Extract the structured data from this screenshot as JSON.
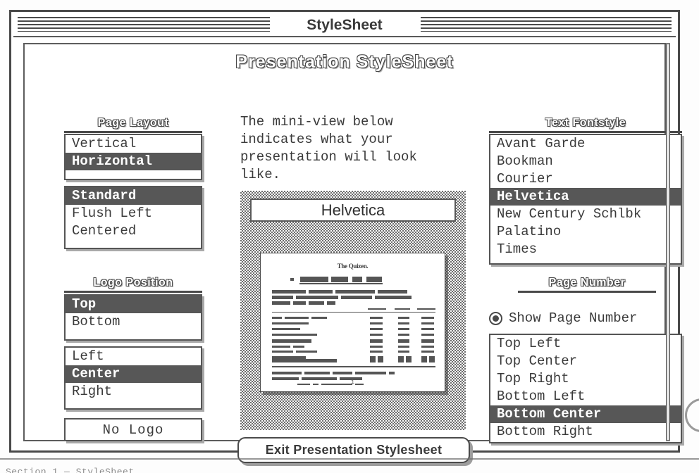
{
  "window": {
    "title": "StyleSheet"
  },
  "headline": "Presentation StyleSheet",
  "instructions": "The mini-view below indicates what your presentation will look like.",
  "page_layout": {
    "header": "Page Layout",
    "orientation_options": [
      {
        "label": "Vertical",
        "selected": false
      },
      {
        "label": "Horizontal",
        "selected": true
      }
    ],
    "alignment_options": [
      {
        "label": "Standard",
        "selected": true
      },
      {
        "label": "Flush Left",
        "selected": false
      },
      {
        "label": "Centered",
        "selected": false
      }
    ]
  },
  "logo_position": {
    "header": "Logo Position",
    "vertical_options": [
      {
        "label": "Top",
        "selected": true
      },
      {
        "label": "Bottom",
        "selected": false
      }
    ],
    "horizontal_options": [
      {
        "label": "Left",
        "selected": false
      },
      {
        "label": "Center",
        "selected": true
      },
      {
        "label": "Right",
        "selected": false
      }
    ],
    "no_logo_label": "No Logo"
  },
  "text_fontstyle": {
    "header": "Text Fontstyle",
    "options": [
      {
        "label": "Avant Garde",
        "selected": false
      },
      {
        "label": "Bookman",
        "selected": false
      },
      {
        "label": "Courier",
        "selected": false
      },
      {
        "label": "Helvetica",
        "selected": true
      },
      {
        "label": "New Century Schlbk",
        "selected": false
      },
      {
        "label": "Palatino",
        "selected": false
      },
      {
        "label": "Times",
        "selected": false
      }
    ]
  },
  "page_number": {
    "header": "Page Number",
    "show_label": "Show Page Number",
    "show_checked": true,
    "options": [
      {
        "label": "Top Left",
        "selected": false
      },
      {
        "label": "Top Center",
        "selected": false
      },
      {
        "label": "Top Right",
        "selected": false
      },
      {
        "label": "Bottom Left",
        "selected": false
      },
      {
        "label": "Bottom Center",
        "selected": true
      },
      {
        "label": "Bottom Right",
        "selected": false
      }
    ]
  },
  "miniview": {
    "font_sample": "Helvetica",
    "thumb_title": "The Quizen.",
    "thumb_page_number": "1"
  },
  "exit_button": "Exit Presentation Stylesheet",
  "scan": {
    "bottom_caption": "Section 1 — StyleSheet"
  },
  "colors": {
    "ink": "#3a3a3a",
    "selection": "#575757",
    "shadow": "#a9a9a9",
    "paper": "#ffffff"
  }
}
